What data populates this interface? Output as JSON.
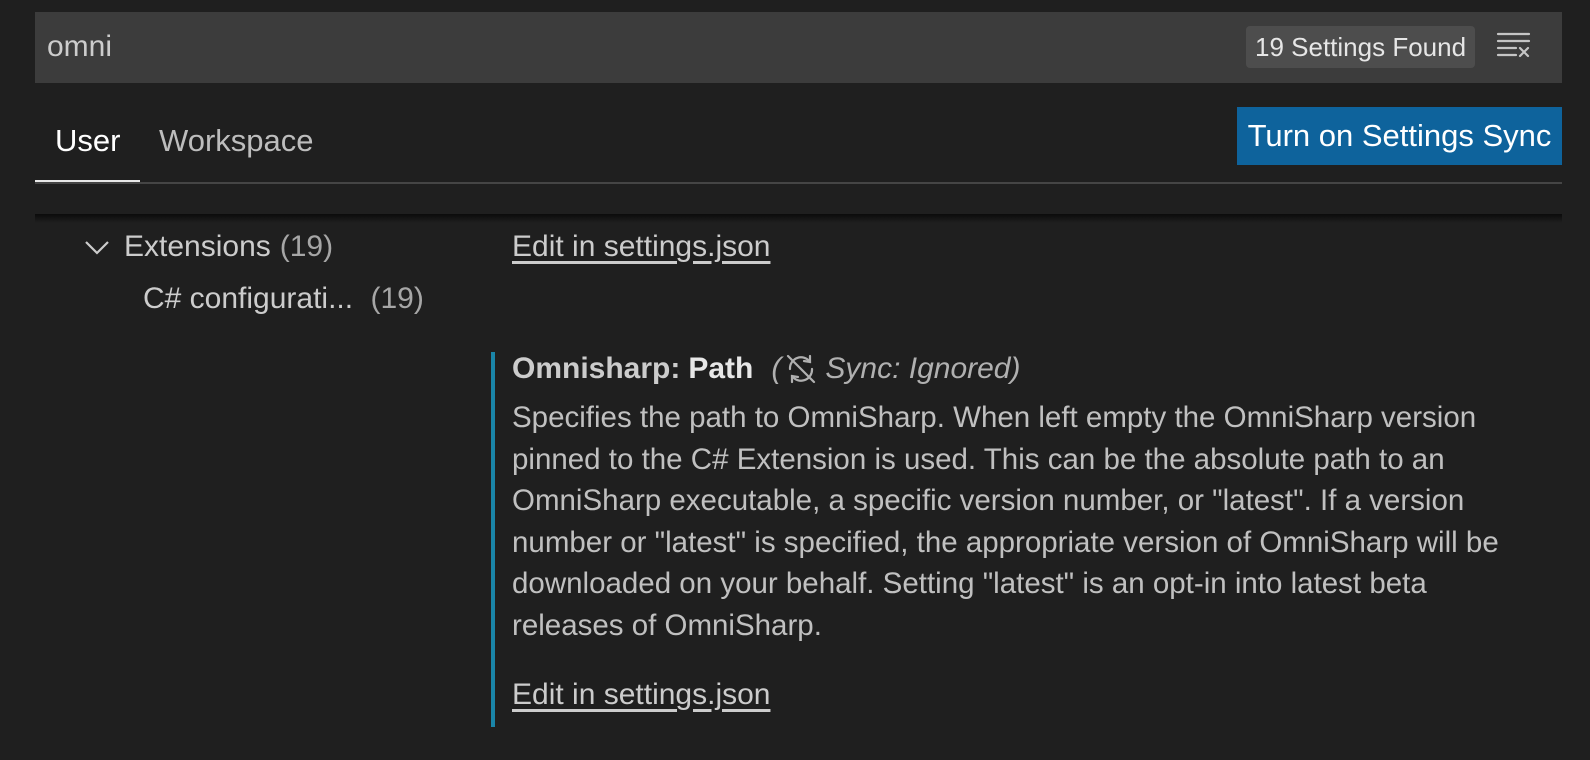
{
  "search": {
    "value": "omni",
    "results_badge": "19 Settings Found",
    "clear_icon": "clear-filter-icon"
  },
  "tabs": {
    "user": "User",
    "workspace": "Workspace",
    "active": "User"
  },
  "sync_button_label": "Turn on Settings Sync",
  "toc": {
    "group_label": "Extensions",
    "group_count": "(19)",
    "item_label": "C# configurati...",
    "item_count": "(19)"
  },
  "edit_link_top": "Edit in settings.json",
  "setting": {
    "category": "Omnisharp:",
    "name": "Path",
    "sync_open": "(",
    "sync_label": "Sync: Ignored)",
    "sync_icon": "sync-ignored-icon",
    "description": "Specifies the path to OmniSharp. When left empty the OmniSharp version pinned to the C# Extension is used. This can be the absolute path to an OmniSharp executable, a specific version number, or \"latest\". If a version number or \"latest\" is specified, the appropriate version of OmniSharp will be downloaded on your behalf. Setting \"latest\" is an opt-in into latest beta releases of OmniSharp.",
    "edit_link": "Edit in settings.json"
  },
  "colors": {
    "background": "#1f1f1f",
    "search_background": "#3c3c3c",
    "button_background": "#0e639c",
    "focus_bar": "#1a85a8"
  }
}
